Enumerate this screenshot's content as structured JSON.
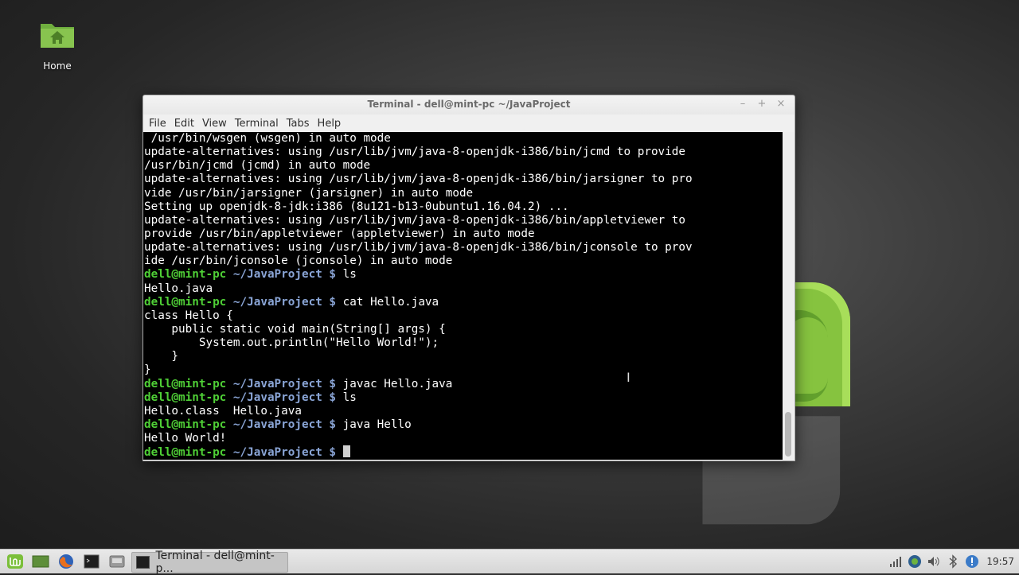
{
  "desktop": {
    "home_label": "Home"
  },
  "window": {
    "title": "Terminal - dell@mint-pc ~/JavaProject",
    "controls": {
      "minimize": "–",
      "maximize": "+",
      "close": "×"
    },
    "menu": [
      "File",
      "Edit",
      "View",
      "Terminal",
      "Tabs",
      "Help"
    ]
  },
  "terminal": {
    "prompt_user": "dell@mint-pc",
    "prompt_path": " ~/JavaProject $",
    "lines": [
      {
        "type": "out",
        "text": " /usr/bin/wsgen (wsgen) in auto mode"
      },
      {
        "type": "out",
        "text": "update-alternatives: using /usr/lib/jvm/java-8-openjdk-i386/bin/jcmd to provide"
      },
      {
        "type": "out",
        "text": "/usr/bin/jcmd (jcmd) in auto mode"
      },
      {
        "type": "out",
        "text": "update-alternatives: using /usr/lib/jvm/java-8-openjdk-i386/bin/jarsigner to pro"
      },
      {
        "type": "out",
        "text": "vide /usr/bin/jarsigner (jarsigner) in auto mode"
      },
      {
        "type": "out",
        "text": "Setting up openjdk-8-jdk:i386 (8u121-b13-0ubuntu1.16.04.2) ..."
      },
      {
        "type": "out",
        "text": "update-alternatives: using /usr/lib/jvm/java-8-openjdk-i386/bin/appletviewer to"
      },
      {
        "type": "out",
        "text": "provide /usr/bin/appletviewer (appletviewer) in auto mode"
      },
      {
        "type": "out",
        "text": "update-alternatives: using /usr/lib/jvm/java-8-openjdk-i386/bin/jconsole to prov"
      },
      {
        "type": "out",
        "text": "ide /usr/bin/jconsole (jconsole) in auto mode"
      },
      {
        "type": "cmd",
        "text": " ls"
      },
      {
        "type": "out",
        "text": "Hello.java"
      },
      {
        "type": "cmd",
        "text": " cat Hello.java"
      },
      {
        "type": "out",
        "text": "class Hello {"
      },
      {
        "type": "out",
        "text": "    public static void main(String[] args) {"
      },
      {
        "type": "out",
        "text": "        System.out.println(\"Hello World!\");"
      },
      {
        "type": "out",
        "text": "    }"
      },
      {
        "type": "out",
        "text": "}"
      },
      {
        "type": "cmd",
        "text": " javac Hello.java"
      },
      {
        "type": "cmd",
        "text": " ls"
      },
      {
        "type": "out",
        "text": "Hello.class  Hello.java"
      },
      {
        "type": "cmd",
        "text": " java Hello"
      },
      {
        "type": "out",
        "text": "Hello World!"
      },
      {
        "type": "cmd",
        "text": " ",
        "cursor": true
      }
    ],
    "colors": {
      "background": "#000000",
      "prompt_user": "#4fcf36",
      "prompt_path": "#8aa5d6"
    }
  },
  "taskbar": {
    "task_label": "Terminal - dell@mint-p...",
    "clock": "19:57",
    "launchers": [
      "mint-menu-icon",
      "show-desktop-icon",
      "firefox-icon",
      "terminal-icon",
      "files-icon"
    ],
    "tray": [
      "network-signal-icon",
      "globe-icon",
      "volume-icon",
      "bluetooth-icon",
      "update-shield-icon"
    ]
  }
}
